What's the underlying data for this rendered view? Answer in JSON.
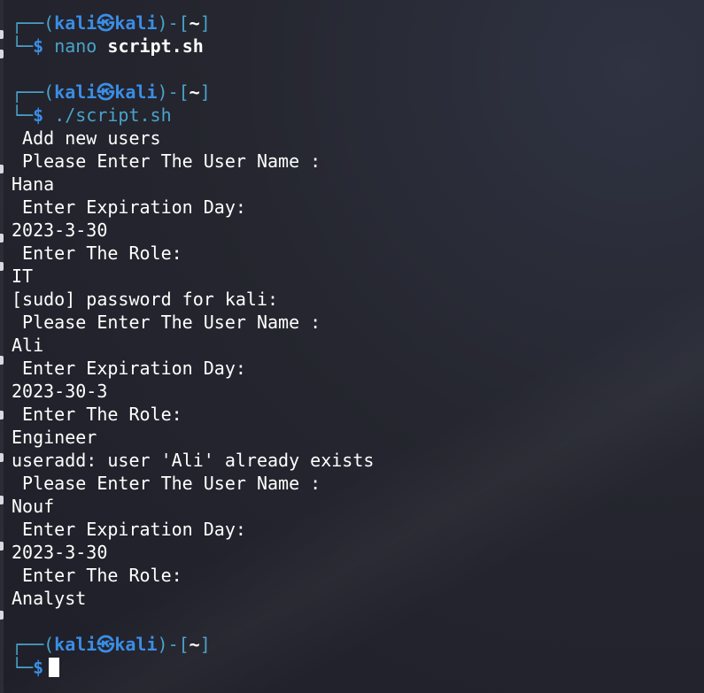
{
  "prompt": {
    "user": "kali",
    "host": "kali",
    "symbol": "㉿",
    "cwd": "~",
    "dollar": "$",
    "open_paren": "(",
    "close_paren": ")",
    "dash": "-",
    "open_bracket": "[",
    "close_bracket": "]",
    "top_corner": "┌──",
    "bottom_corner": "└─"
  },
  "session": [
    {
      "command": "nano",
      "argument": "script.sh"
    },
    {
      "command": "./script.sh",
      "argument": ""
    }
  ],
  "output_lines": [
    " Add new users",
    " Please Enter The User Name :",
    "Hana",
    " Enter Expiration Day:",
    "2023-3-30",
    " Enter The Role:",
    "IT",
    "[sudo] password for kali:",
    " Please Enter The User Name :",
    "Ali",
    " Enter Expiration Day:",
    "2023-30-3",
    " Enter The Role:",
    "Engineer",
    "useradd: user 'Ali' already exists",
    " Please Enter The User Name :",
    "Nouf",
    " Enter Expiration Day:",
    "2023-3-30",
    " Enter The Role:",
    "Analyst"
  ],
  "colors": {
    "background": "#23232e",
    "prompt_user": "#3a8ee6",
    "prompt_frame": "#4aa3c9",
    "text": "#ffffff"
  }
}
